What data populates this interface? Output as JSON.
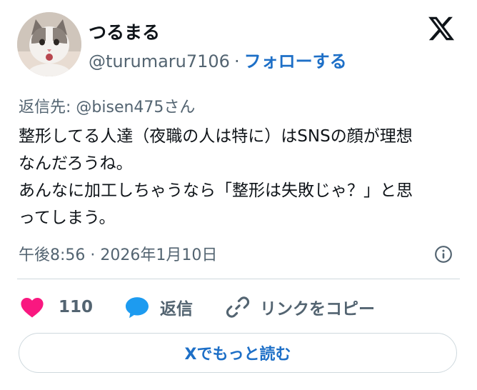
{
  "author": {
    "display_name": "つるまる",
    "handle": "@turumaru7106",
    "separator": "·",
    "follow_label": "フォローする"
  },
  "tweet": {
    "reply_to": "返信先: @bisen475さん",
    "lines": [
      "整形してる人達（夜職の人は特に）はSNSの顔が理想",
      "なんだろうね。",
      "あんなに加工しちゃうなら「整形は失敗じゃ？」と思",
      "ってしまう。"
    ],
    "timestamp": "午後8:56 · 2026年1月10日"
  },
  "actions": {
    "like_count": "110",
    "reply_label": "返信",
    "copy_link_label": "リンクをコピー"
  },
  "read_more_label": "Xでもっと読む",
  "colors": {
    "like": "#f91880",
    "reply": "#1d9bf0",
    "link": "#1d6fc7",
    "muted": "#536471",
    "border": "#cfd9de"
  },
  "icons": {
    "brand": "x-logo-icon",
    "info": "info-icon",
    "like": "heart-icon",
    "reply": "speech-bubble-icon",
    "copy": "link-icon"
  }
}
